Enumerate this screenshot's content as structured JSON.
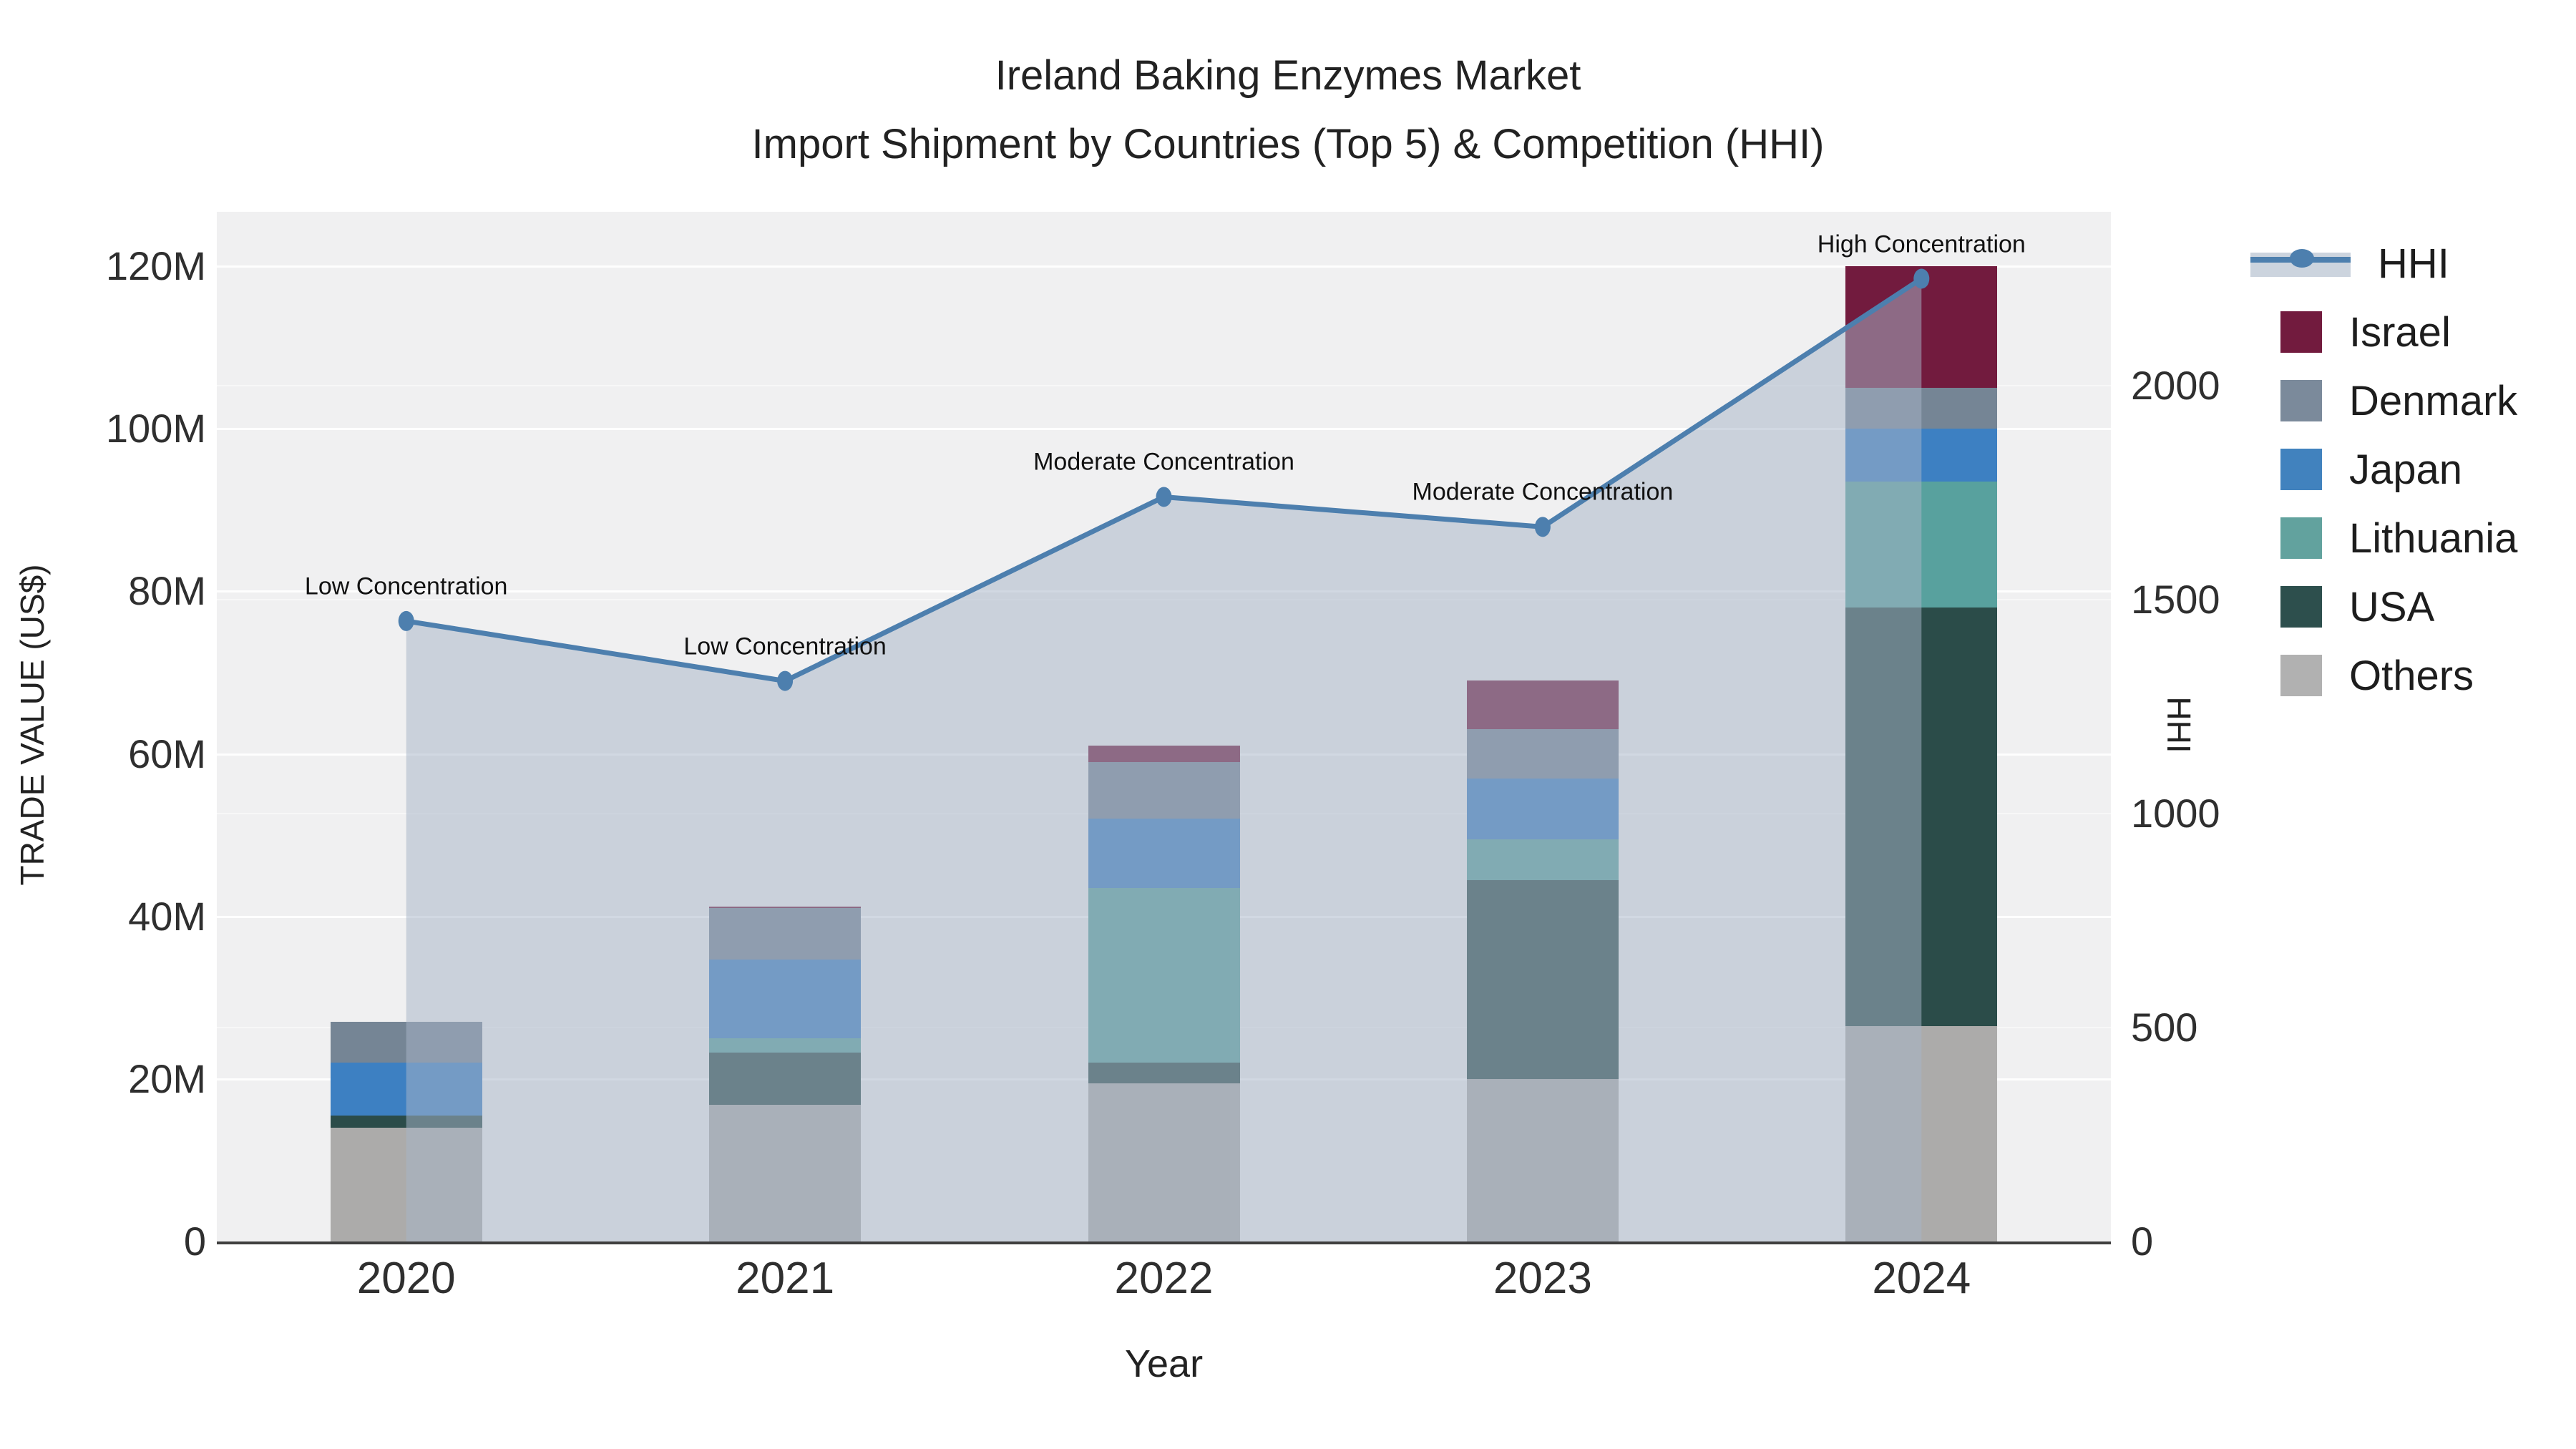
{
  "title": {
    "line1": "Ireland Baking Enzymes Market",
    "line2": "Import Shipment by Countries (Top 5) & Competition (HHI)"
  },
  "chart_data": {
    "type": "bar+line",
    "categories": [
      "2020",
      "2021",
      "2022",
      "2023",
      "2024"
    ],
    "bar_unit": "M US$",
    "series": [
      {
        "name": "Others",
        "color": "#acabaa",
        "values": [
          14.0,
          16.8,
          19.5,
          20.0,
          26.5
        ]
      },
      {
        "name": "USA",
        "color": "#2b4c49",
        "values": [
          1.5,
          6.4,
          2.5,
          24.5,
          51.5
        ]
      },
      {
        "name": "Lithuania",
        "color": "#58a19e",
        "values": [
          0,
          1.8,
          21.5,
          5.0,
          15.5
        ]
      },
      {
        "name": "Japan",
        "color": "#3d80c2",
        "values": [
          6.5,
          9.7,
          8.5,
          7.5,
          6.5
        ]
      },
      {
        "name": "Denmark",
        "color": "#758595",
        "values": [
          5.0,
          6.3,
          7.0,
          6.0,
          5.0
        ]
      },
      {
        "name": "Israel",
        "color": "#721b3e",
        "values": [
          0,
          0.2,
          2.0,
          6.0,
          15.0
        ]
      }
    ],
    "hhi": {
      "name": "HHI",
      "values": [
        1450,
        1310,
        1740,
        1670,
        2250
      ],
      "line_color": "#4d7fae",
      "fill_color": "rgba(167,180,200,0.52)",
      "swatch_fill": "#ccd4de"
    },
    "annotations": [
      {
        "year": "2020",
        "text": "Low Concentration"
      },
      {
        "year": "2021",
        "text": "Low Concentration"
      },
      {
        "year": "2022",
        "text": "Moderate Concentration"
      },
      {
        "year": "2023",
        "text": "Moderate Concentration"
      },
      {
        "year": "2024",
        "text": "High Concentration"
      }
    ],
    "y_left": {
      "title": "TRADE VALUE (US$)",
      "tick_labels": [
        "0",
        "20M",
        "40M",
        "60M",
        "80M",
        "100M",
        "120M"
      ],
      "tick_values": [
        0,
        20,
        40,
        60,
        80,
        100,
        120
      ],
      "max": 126.7
    },
    "y_right": {
      "title": "HHI",
      "tick_labels": [
        "0",
        "500",
        "1000",
        "1500",
        "2000"
      ],
      "tick_values": [
        0,
        500,
        1000,
        1500,
        2000
      ],
      "max": 2406
    },
    "x": {
      "title": "Year"
    },
    "layout": {
      "grid": true,
      "legend_position": "right",
      "plot_bg": "#f0f0f1"
    }
  },
  "legend": {
    "items": [
      {
        "label": "HHI",
        "type": "line",
        "color": "#4d7fae"
      },
      {
        "label": "Israel",
        "type": "square",
        "color": "#721b3e"
      },
      {
        "label": "Denmark",
        "type": "square",
        "color": "#7b8a9b"
      },
      {
        "label": "Japan",
        "type": "square",
        "color": "#4182be"
      },
      {
        "label": "Lithuania",
        "type": "square",
        "color": "#62a29e"
      },
      {
        "label": "USA",
        "type": "square",
        "color": "#2d4f4d"
      },
      {
        "label": "Others",
        "type": "square",
        "color": "#b1b1b1"
      }
    ]
  }
}
